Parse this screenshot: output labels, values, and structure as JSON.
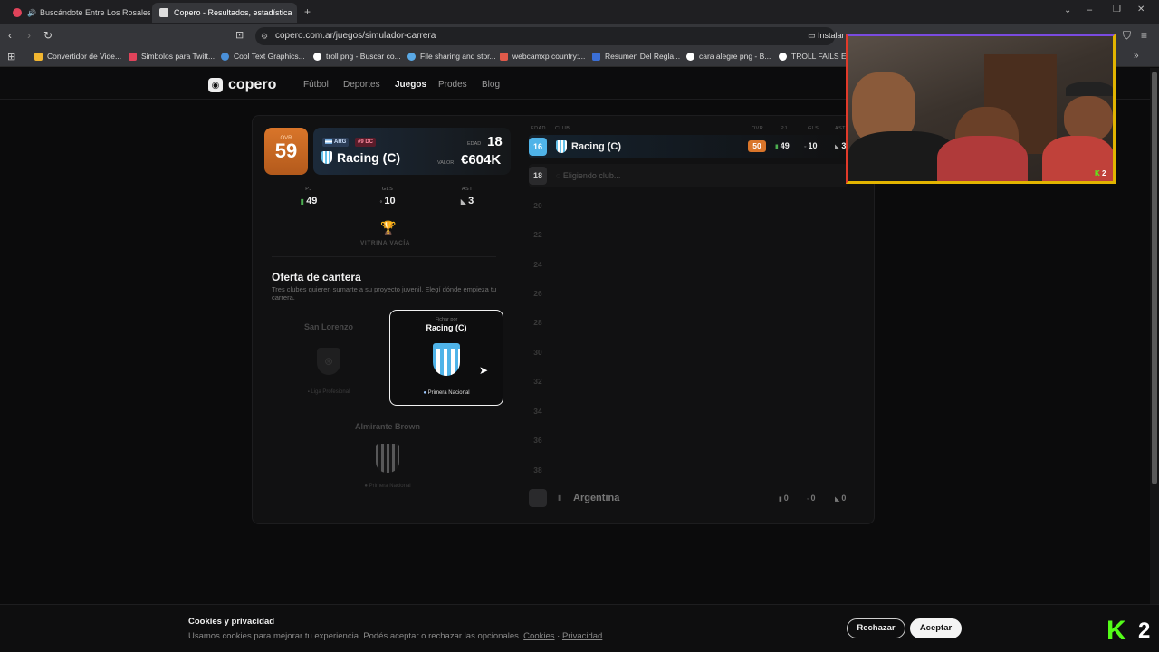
{
  "browser": {
    "tabs": [
      {
        "title": "Buscándote Entre Los Rosales | Yo",
        "active": false
      },
      {
        "title": "Copero - Resultados, estadística",
        "active": true
      }
    ],
    "new_tab": "+",
    "url": "copero.com.ar/juegos/simulador-carrera",
    "install_label": "Instalar",
    "bookmarks": [
      "Convertidor de Vide...",
      "Simbolos para Twitt...",
      "Cool Text Graphics...",
      "troll png - Buscar co...",
      "File sharing and stor...",
      "webcamxp country:...",
      "Resumen Del Regla...",
      "cara alegre png - B...",
      "TROLL FAILS ENG"
    ]
  },
  "site": {
    "logo": "copero",
    "nav": [
      "Fútbol",
      "Deportes",
      "Juegos",
      "Prodes",
      "Blog"
    ],
    "active_nav": "Juegos"
  },
  "player": {
    "ovr_label": "OVR",
    "ovr": "59",
    "nation_tag": "ARG",
    "position_tag": "#9 DC",
    "club": "Racing (C)",
    "age_label": "EDAD",
    "age": "18",
    "value_label": "VALOR",
    "value": "€604K",
    "stats": [
      {
        "label": "PJ",
        "value": "49"
      },
      {
        "label": "GLS",
        "value": "10"
      },
      {
        "label": "AST",
        "value": "3"
      }
    ],
    "trophies": "VITRINA VACÍA"
  },
  "offer": {
    "title": "Oferta de cantera",
    "description": "Tres clubes quieren sumarte a su proyecto juvenil. Elegí dónde empieza tu carrera.",
    "clubs": [
      {
        "name": "San Lorenzo",
        "league": "Liga Profesional",
        "selected": false
      },
      {
        "name": "Racing (C)",
        "prefix": "Fichar por",
        "league": "Primera Nacional",
        "selected": true
      },
      {
        "name": "Almirante Brown",
        "league": "Primera Nacional",
        "selected": false
      }
    ]
  },
  "timeline": {
    "headers": [
      "EDAD",
      "CLUB",
      "OVR",
      "PJ",
      "GLS",
      "AST"
    ],
    "rows": [
      {
        "age": "16",
        "club": "Racing (C)",
        "ovr": "50",
        "pj": "49",
        "gls": "10",
        "ast": "3"
      },
      {
        "age": "18",
        "club": "Eligiendo club..."
      }
    ],
    "future_ages": [
      "20",
      "22",
      "24",
      "26",
      "28",
      "30",
      "32",
      "34",
      "36",
      "38"
    ],
    "national": {
      "team": "Argentina",
      "pj": "0",
      "gls": "0",
      "ast": "0"
    }
  },
  "cookies": {
    "title": "Cookies y privacidad",
    "text": "Usamos cookies para mejorar tu experiencia. Podés aceptar o rechazar las opcionales.",
    "cookies_link": "Cookies",
    "separator": "·",
    "privacy_link": "Privacidad",
    "reject": "Rechazar",
    "accept": "Aceptar"
  },
  "overlay": {
    "kick_count": "2",
    "kick_logo": "K"
  },
  "colors": {
    "ovr_orange": "#d9752a",
    "racing_blue": "#4fb3e8",
    "accent_red": "#e0435a"
  }
}
